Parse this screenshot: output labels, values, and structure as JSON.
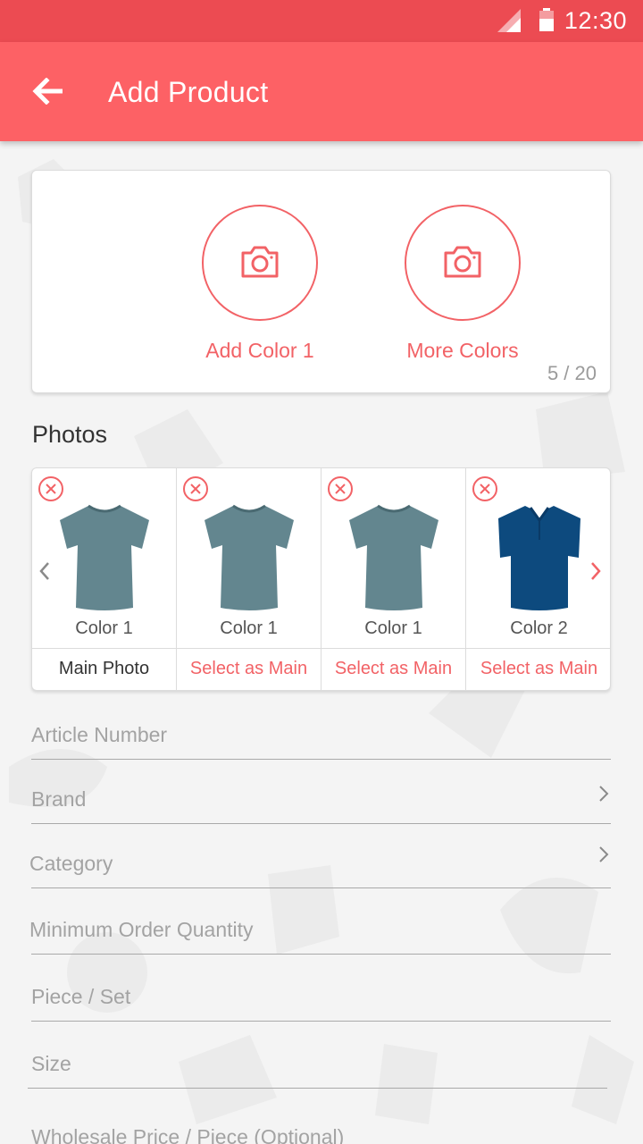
{
  "status_bar": {
    "time": "12:30",
    "icons": [
      "signal-icon",
      "battery-icon"
    ]
  },
  "app_bar": {
    "title": "Add Product",
    "back_icon": "arrow-left-icon"
  },
  "colors": {
    "actions": [
      {
        "label": "Add Color 1",
        "icon": "camera-icon"
      },
      {
        "label": "More Colors",
        "icon": "camera-icon"
      }
    ],
    "counter": "5 / 20"
  },
  "photos": {
    "title": "Photos",
    "items": [
      {
        "color_label": "Color 1",
        "action": "Main Photo",
        "is_main": true,
        "shirt": "tshirt",
        "shirt_color": "#63868f"
      },
      {
        "color_label": "Color 1",
        "action": "Select as Main",
        "is_main": false,
        "shirt": "tshirt",
        "shirt_color": "#63868f"
      },
      {
        "color_label": "Color 1",
        "action": "Select as Main",
        "is_main": false,
        "shirt": "tshirt",
        "shirt_color": "#63868f"
      },
      {
        "color_label": "Color 2",
        "action": "Select as Main",
        "is_main": false,
        "shirt": "polo",
        "shirt_color": "#0d4a7e"
      }
    ]
  },
  "form": {
    "fields": [
      {
        "placeholder": "Article Number",
        "chevron": false
      },
      {
        "placeholder": "Brand",
        "chevron": true
      },
      {
        "placeholder": "Category",
        "chevron": true
      },
      {
        "placeholder": "Minimum Order Quantity",
        "chevron": false
      },
      {
        "placeholder": "Piece / Set",
        "chevron": false
      },
      {
        "placeholder": "Size",
        "chevron": false
      },
      {
        "placeholder": "Wholesale Price / Piece (Optional)",
        "chevron": false
      }
    ]
  },
  "theme": {
    "primary": "#fd6165",
    "status_bar": "#ec4b52",
    "accent": "#f26266"
  }
}
